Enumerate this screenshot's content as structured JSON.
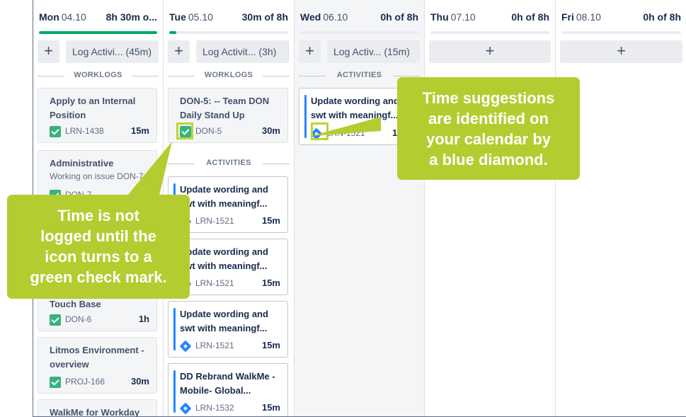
{
  "days": [
    {
      "name": "Mon",
      "date": "04.10",
      "total": "8h 30m o...",
      "progress": 1.0,
      "log_label": "Log Activi... (45m)",
      "section1": "WORKLOGS"
    },
    {
      "name": "Tue",
      "date": "05.10",
      "total": "30m of 8h",
      "progress": 0.06,
      "log_label": "Log Activit... (3h)",
      "section1": "WORKLOGS",
      "section2": "ACTIVITIES"
    },
    {
      "name": "Wed",
      "date": "06.10",
      "total": "0h of 8h",
      "progress": 0,
      "log_label": "Log Activ... (15m)",
      "section1": "ACTIVITIES"
    },
    {
      "name": "Thu",
      "date": "07.10",
      "total": "0h of 8h",
      "progress": 0
    },
    {
      "name": "Fri",
      "date": "08.10",
      "total": "0h of 8h",
      "progress": 0
    }
  ],
  "add_symbol": "+",
  "mon_cards": [
    {
      "title": "Apply to an Internal Position",
      "key": "LRN-1438",
      "dur": "15m"
    },
    {
      "title": "Administrative",
      "sub": "Working on issue DON-7",
      "key": "DON-7",
      "dur": ""
    },
    {
      "title": "Touch Base",
      "key": "DON-6",
      "dur": "1h"
    },
    {
      "title": "Litmos Environment - overview",
      "key": "PROJ-166",
      "dur": "30m"
    },
    {
      "title": "WalkMe for Workday"
    }
  ],
  "tue_worklog": {
    "title": "DON-5: -- Team DON Daily Stand Up",
    "key": "DON-5",
    "dur": "30m"
  },
  "tue_activities": [
    {
      "title": "Update wording and swt with meaningf...",
      "key": "LRN-1521",
      "dur": "15m"
    },
    {
      "title": "Update wording and swt with meaningf...",
      "key": "LRN-1521",
      "dur": "15m"
    },
    {
      "title": "Update wording and swt with meaningf...",
      "key": "LRN-1521",
      "dur": "15m"
    },
    {
      "title": "DD Rebrand WalkMe - Mobile- Global...",
      "key": "LRN-1532",
      "dur": "15m"
    }
  ],
  "wed_activity": {
    "title": "Update wording and swt with meaningf...",
    "key": "LRN-1521",
    "dur": "15m"
  },
  "callouts": {
    "left": [
      "Time is not",
      "logged until the",
      "icon turns to a",
      "green check mark."
    ],
    "right": [
      "Time suggestions",
      "are identified on",
      "your calendar by",
      "a blue diamond."
    ]
  },
  "colors": {
    "callout": "#b5cc30",
    "highlight": "#bed62f",
    "progress": "#00a86b",
    "diamond": "#2684ff",
    "check": "#36b37e"
  },
  "icons": {
    "check": "check-square-icon",
    "diamond": "jira-diamond-icon",
    "add": "plus-icon"
  }
}
